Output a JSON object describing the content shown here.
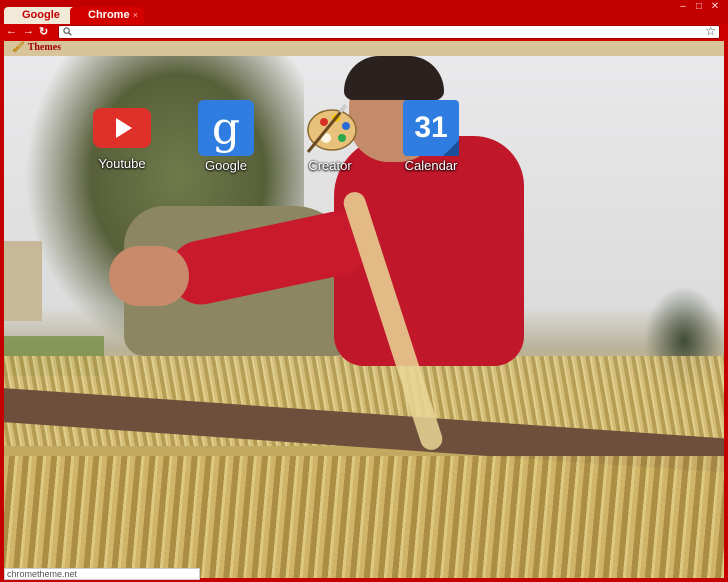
{
  "window": {
    "controls": [
      "–",
      "□",
      "✕"
    ]
  },
  "tabs": [
    {
      "label": "Google",
      "active": true,
      "close": "×"
    },
    {
      "label": "Chrome",
      "active": false,
      "close": "×"
    }
  ],
  "toolbar": {
    "back": "←",
    "forward": "→",
    "reload": "↻",
    "search_icon": "search-icon",
    "star_icon": "star-icon",
    "omnibox_value": ""
  },
  "bookmarks": [
    {
      "label": "Themes",
      "icon": "paintbrush-icon"
    }
  ],
  "apps": [
    {
      "label": "Youtube",
      "icon": "youtube-icon"
    },
    {
      "label": "Google",
      "icon": "google-icon",
      "glyph": "g"
    },
    {
      "label": "Creator",
      "icon": "palette-icon"
    },
    {
      "label": "Calendar",
      "icon": "calendar-icon",
      "glyph": "31"
    }
  ],
  "status": {
    "text": "chrometheme.net"
  },
  "colors": {
    "frame": "#c40000",
    "accent": "#c00000",
    "bookmarks_bar": "#d8c49a"
  }
}
